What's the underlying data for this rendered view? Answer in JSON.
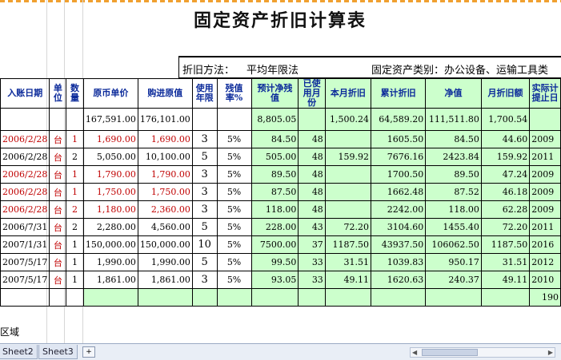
{
  "title": "固定资产折旧计算表",
  "method_label": "折旧方法：",
  "method_value": "平均年限法",
  "category_label": "固定资产类别：办公设备、运输工具类",
  "headers": [
    "入账日期",
    "单位",
    "数量",
    "原币单价",
    "购进原值",
    "使用年限",
    "残值率%",
    "预计净残值",
    "已使用月份",
    "本月折旧",
    "累计折旧",
    "净值",
    "月折旧额",
    "实际计提止日"
  ],
  "totals": {
    "unit_price": "167,591.00",
    "original_value": "176,101.00",
    "salvage": "8,805.05",
    "month_dep": "1,500.24",
    "accum_dep": "64,589.20",
    "net": "111,511.80",
    "monthly": "1,700.54"
  },
  "rows": [
    {
      "date": "2006/2/28",
      "unit": "台",
      "qty": "1",
      "price": "1,690.00",
      "orig": "1,690.00",
      "years": "3",
      "rate": "5%",
      "salvage": "84.50",
      "used": "48",
      "month": "",
      "accum": "1605.50",
      "net": "84.50",
      "monthly": "44.60",
      "end": "2009",
      "red": true
    },
    {
      "date": "2006/2/28",
      "unit": "台",
      "qty": "2",
      "price": "5,050.00",
      "orig": "10,100.00",
      "years": "5",
      "rate": "5%",
      "salvage": "505.00",
      "used": "48",
      "month": "159.92",
      "accum": "7676.16",
      "net": "2423.84",
      "monthly": "159.92",
      "end": "2011",
      "red": false
    },
    {
      "date": "2006/2/28",
      "unit": "台",
      "qty": "1",
      "price": "1,790.00",
      "orig": "1,790.00",
      "years": "3",
      "rate": "5%",
      "salvage": "89.50",
      "used": "48",
      "month": "",
      "accum": "1700.50",
      "net": "89.50",
      "monthly": "47.24",
      "end": "2009",
      "red": true
    },
    {
      "date": "2006/2/28",
      "unit": "台",
      "qty": "1",
      "price": "1,750.00",
      "orig": "1,750.00",
      "years": "3",
      "rate": "5%",
      "salvage": "87.50",
      "used": "48",
      "month": "",
      "accum": "1662.48",
      "net": "87.52",
      "monthly": "46.18",
      "end": "2009",
      "red": true
    },
    {
      "date": "2006/2/28",
      "unit": "台",
      "qty": "2",
      "price": "1,180.00",
      "orig": "2,360.00",
      "years": "3",
      "rate": "5%",
      "salvage": "118.00",
      "used": "48",
      "month": "",
      "accum": "2242.00",
      "net": "118.00",
      "monthly": "62.28",
      "end": "2009",
      "red": true
    },
    {
      "date": "2006/7/31",
      "unit": "台",
      "qty": "2",
      "price": "2,280.00",
      "orig": "4,560.00",
      "years": "5",
      "rate": "5%",
      "salvage": "228.00",
      "used": "43",
      "month": "72.20",
      "accum": "3104.60",
      "net": "1455.40",
      "monthly": "72.20",
      "end": "2011",
      "red": false
    },
    {
      "date": "2007/1/31",
      "unit": "台",
      "qty": "1",
      "price": "150,000.00",
      "orig": "150,000.00",
      "years": "10",
      "rate": "5%",
      "salvage": "7500.00",
      "used": "37",
      "month": "1187.50",
      "accum": "43937.50",
      "net": "106062.50",
      "monthly": "1187.50",
      "end": "2016",
      "red": false
    },
    {
      "date": "2007/5/17",
      "unit": "台",
      "qty": "1",
      "price": "1,990.00",
      "orig": "1,990.00",
      "years": "5",
      "rate": "5%",
      "salvage": "99.50",
      "used": "33",
      "month": "31.51",
      "accum": "1039.83",
      "net": "950.17",
      "monthly": "31.51",
      "end": "2012",
      "red": false
    },
    {
      "date": "2007/5/17",
      "unit": "台",
      "qty": "1",
      "price": "1,861.00",
      "orig": "1,861.00",
      "years": "3",
      "rate": "5%",
      "salvage": "93.05",
      "used": "33",
      "month": "49.11",
      "accum": "1620.63",
      "net": "240.37",
      "monthly": "49.11",
      "end": "2010",
      "red": false
    }
  ],
  "extra_row_end": "190",
  "area_text": "区域",
  "sheet_tabs": [
    "Sheet2",
    "Sheet3"
  ]
}
